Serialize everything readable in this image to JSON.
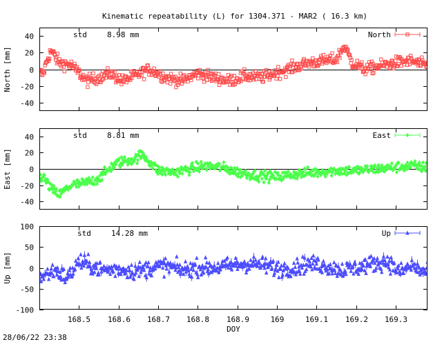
{
  "title": "Kinematic repeatability (L) for 1304.371 - MAR2  ( 16.3 km)",
  "footer_timestamp": "28/06/22 23:38",
  "chart_data": [
    {
      "type": "scatter",
      "panel": "north",
      "ylabel": "North [mm]",
      "legend": "North",
      "legend_position": "top-right",
      "std_label": "std",
      "std_value": "8.98 mm",
      "color": "#ff4c4c",
      "marker": "open-square",
      "xlim": [
        168.4,
        169.38
      ],
      "ylim": [
        -50,
        50
      ],
      "yticks": [
        "40",
        "20",
        "0",
        "-20",
        "-40"
      ],
      "zero_line": true,
      "series": [
        {
          "x": [
            168.41,
            168.42,
            168.43,
            168.45,
            168.48,
            168.52,
            168.55,
            168.58,
            168.61,
            168.64,
            168.68,
            168.72,
            168.76,
            168.8,
            168.84,
            168.88,
            168.92,
            168.96,
            169.0,
            169.04,
            169.08,
            169.12,
            169.15,
            169.17,
            169.19,
            169.22,
            169.26,
            169.3,
            169.34,
            169.37
          ],
          "y": [
            -5,
            12,
            22,
            8,
            5,
            -14,
            -10,
            -5,
            -14,
            -8,
            0,
            -10,
            -14,
            -5,
            -10,
            -14,
            -8,
            -10,
            -4,
            2,
            8,
            10,
            12,
            28,
            8,
            0,
            4,
            8,
            10,
            5
          ]
        }
      ]
    },
    {
      "type": "scatter",
      "panel": "east",
      "ylabel": "East [mm]",
      "legend": "East",
      "legend_position": "top-right",
      "std_label": "std",
      "std_value": "8.81 mm",
      "color": "#4cff4c",
      "marker": "diamond",
      "xlim": [
        168.4,
        169.38
      ],
      "ylim": [
        -50,
        50
      ],
      "yticks": [
        "40",
        "20",
        "0",
        "-20",
        "-40"
      ],
      "zero_line": true,
      "series": [
        {
          "x": [
            168.41,
            168.43,
            168.45,
            168.48,
            168.51,
            168.54,
            168.56,
            168.58,
            168.6,
            168.62,
            168.64,
            168.66,
            168.68,
            168.7,
            168.74,
            168.78,
            168.82,
            168.86,
            168.9,
            168.95,
            169.0,
            169.05,
            169.1,
            169.15,
            169.2,
            169.25,
            169.3,
            169.34,
            169.37
          ],
          "y": [
            -10,
            -25,
            -32,
            -20,
            -18,
            -14,
            -8,
            2,
            8,
            10,
            12,
            18,
            8,
            -2,
            -4,
            0,
            4,
            2,
            -4,
            -8,
            -10,
            -6,
            -4,
            -2,
            -2,
            0,
            2,
            4,
            2
          ]
        }
      ]
    },
    {
      "type": "scatter",
      "panel": "up",
      "ylabel": "Up [mm]",
      "legend": "Up",
      "legend_position": "top-right",
      "std_label": "std",
      "std_value": "14.28 mm",
      "color": "#4c4cff",
      "marker": "triangle",
      "xlim": [
        168.4,
        169.38
      ],
      "ylim": [
        -100,
        100
      ],
      "yticks": [
        "100",
        "50",
        "0",
        "-50",
        "-100"
      ],
      "xticks": [
        "168.5",
        "168.6",
        "168.7",
        "168.8",
        "168.9",
        "169",
        "169.1",
        "169.2",
        "169.3"
      ],
      "xlabel": "DOY",
      "zero_line": false,
      "series": [
        {
          "x": [
            168.41,
            168.44,
            168.47,
            168.5,
            168.53,
            168.56,
            168.6,
            168.64,
            168.68,
            168.72,
            168.76,
            168.8,
            168.84,
            168.88,
            168.92,
            168.96,
            169.0,
            169.04,
            169.08,
            169.12,
            169.16,
            169.2,
            169.24,
            169.28,
            169.31,
            169.34,
            169.37
          ],
          "y": [
            -20,
            -5,
            -25,
            15,
            5,
            -5,
            -3,
            -8,
            0,
            5,
            -5,
            2,
            0,
            5,
            10,
            8,
            -2,
            0,
            10,
            5,
            -5,
            0,
            10,
            15,
            -10,
            5,
            -10
          ]
        }
      ]
    }
  ]
}
